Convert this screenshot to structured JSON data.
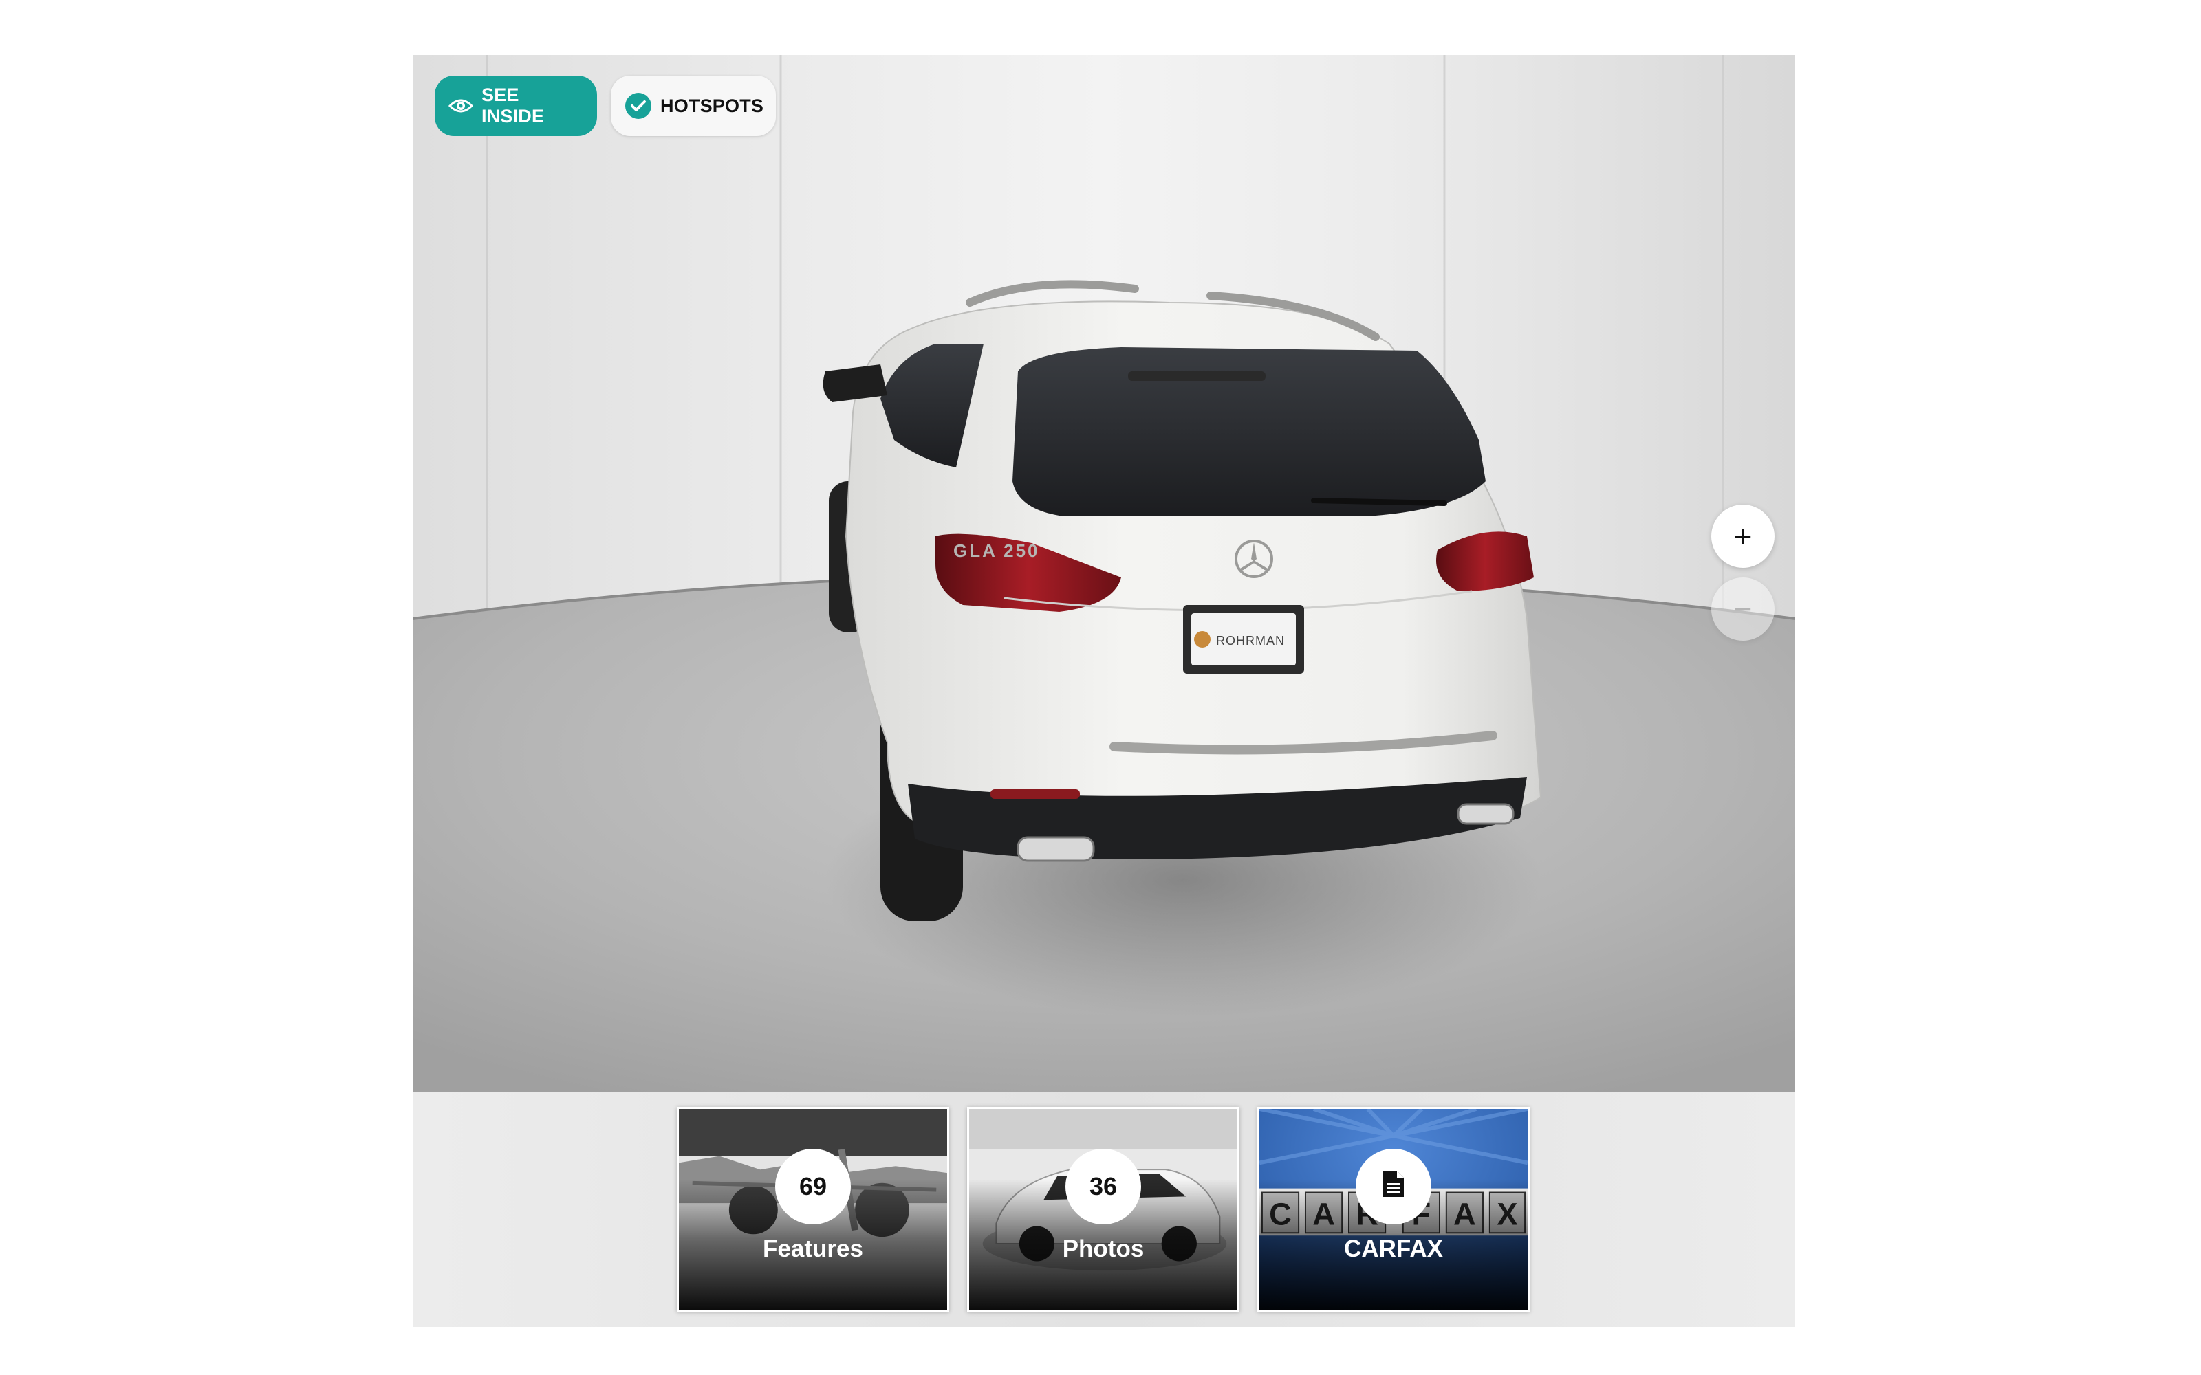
{
  "viewer": {
    "controls": {
      "see_inside_label": "SEE INSIDE",
      "see_inside_icon": "eye-icon",
      "hotspots_label": "HOTSPOTS",
      "hotspots_icon": "check-circle-icon",
      "zoom_in_label": "+",
      "zoom_out_label": "−"
    },
    "vehicle": {
      "model_badge": "GLA 250",
      "plate_frame": "ROHRMAN"
    },
    "accent_color": "#17a298"
  },
  "tiles": [
    {
      "count": "69",
      "label": "Features"
    },
    {
      "count": "36",
      "label": "Photos"
    },
    {
      "icon": "document-icon",
      "label": "CARFAX",
      "logo_letters": [
        "C",
        "A",
        "R",
        "F",
        "A",
        "X"
      ]
    }
  ]
}
